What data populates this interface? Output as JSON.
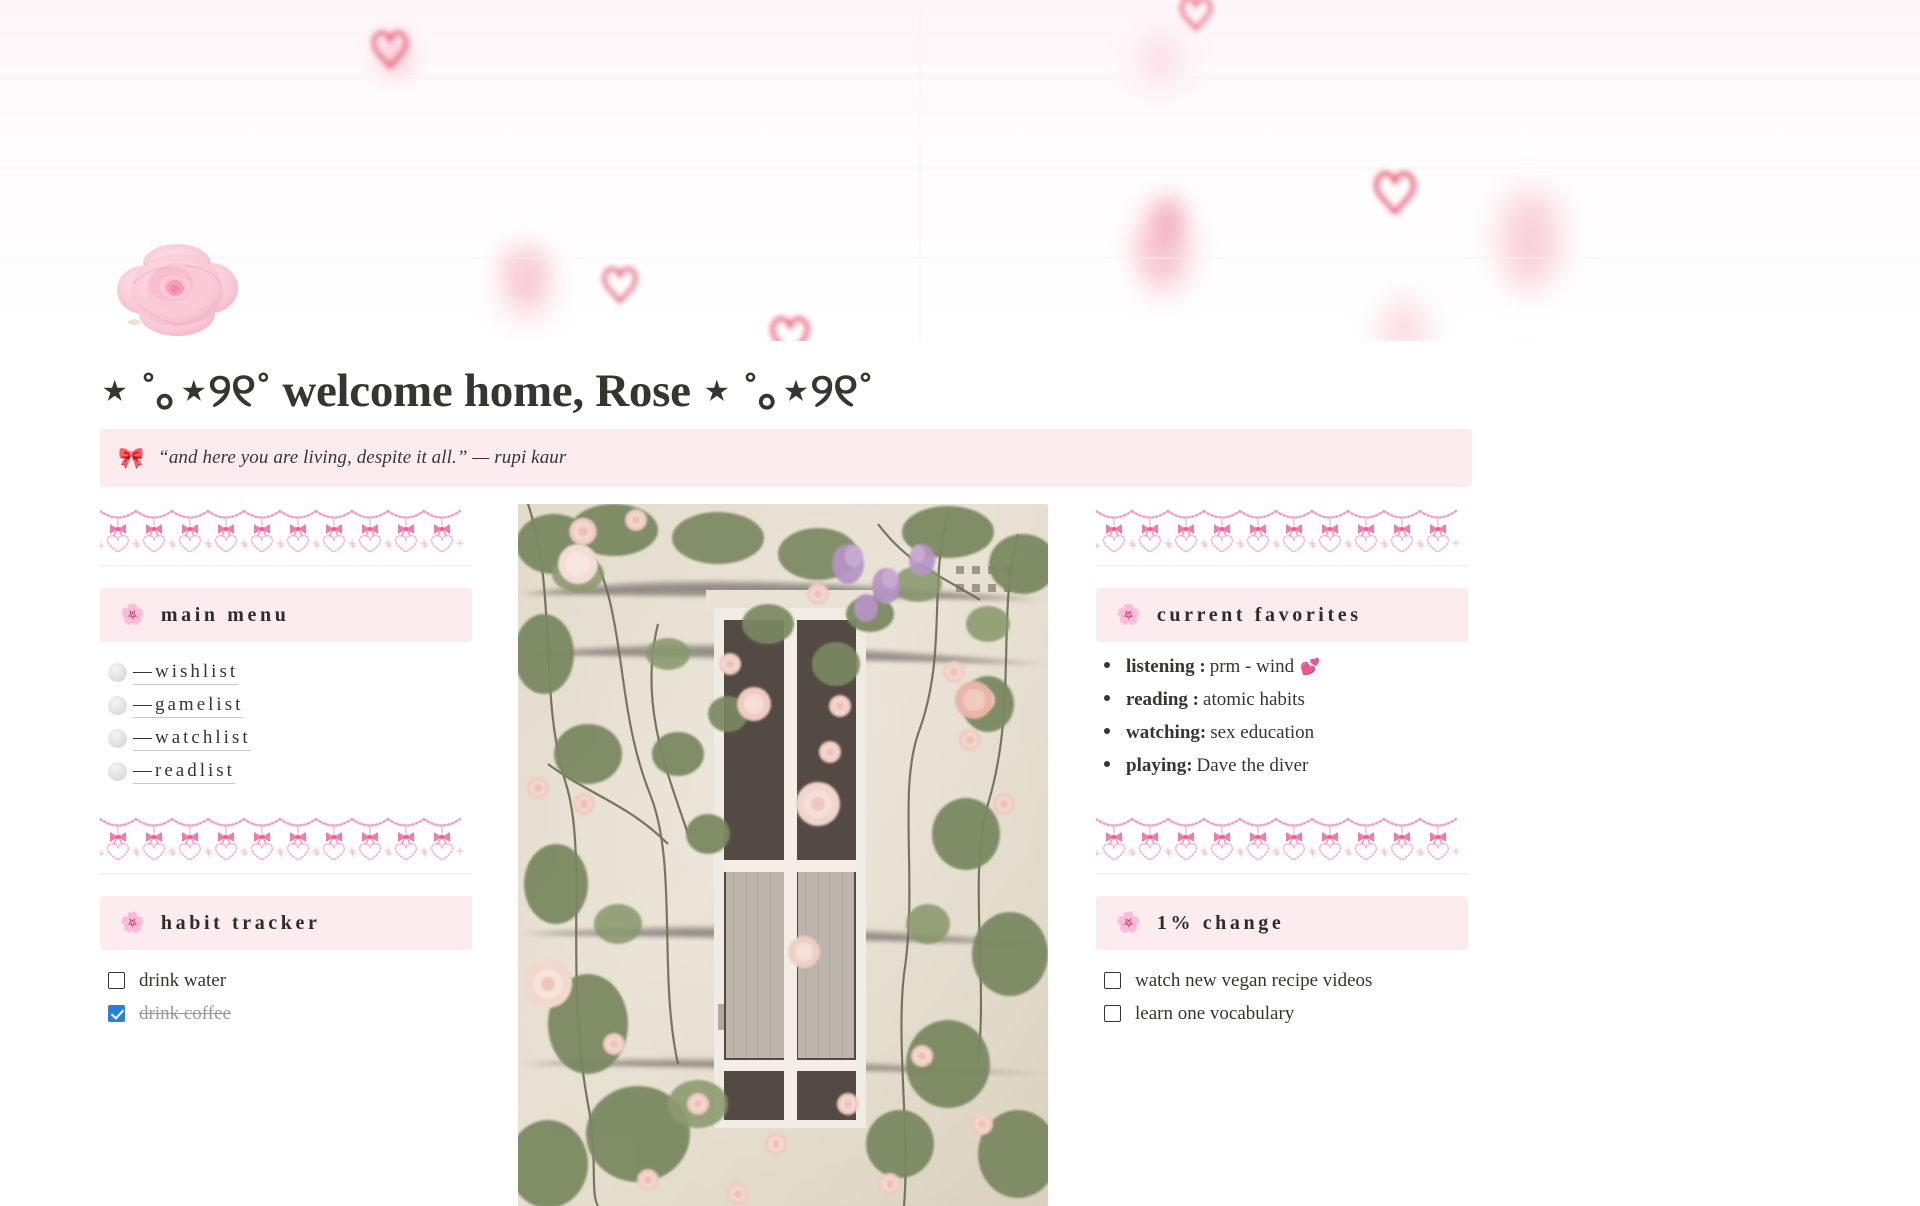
{
  "cover": {
    "name": "pink-hearts-cover",
    "background": "#fffdfd",
    "accent": "#e8617f"
  },
  "page": {
    "icon": "pink-rose",
    "title": "⋆ ˚｡⋆୨୧˚ welcome home, Rose ⋆ ˚｡⋆୨୧˚"
  },
  "callout": {
    "icon": "🎀",
    "icon_name": "pink-bow",
    "text": "“and here you are living, despite it all.” — rupi kaur",
    "background": "#fcecf0"
  },
  "theme": {
    "band_background": "#fcecf0",
    "text": "#37352f",
    "muted": "#9b9a97",
    "checkbox_checked": "#2383e2",
    "lace_pink": "#f5a8c4",
    "divider": "#ededec"
  },
  "left_column": {
    "divider_top": "lace-bow-heart-border",
    "main_menu": {
      "icon": "🌸",
      "icon_name": "cherry-blossom",
      "title": "main menu",
      "items": [
        {
          "bullet": "white-circle",
          "label": "—wishlist"
        },
        {
          "bullet": "white-circle",
          "label": "—gamelist"
        },
        {
          "bullet": "white-circle",
          "label": "—watchlist"
        },
        {
          "bullet": "white-circle",
          "label": "—readlist"
        }
      ]
    },
    "divider_mid": "lace-bow-heart-border",
    "habit_tracker": {
      "icon": "🌸",
      "icon_name": "cherry-blossom",
      "title": "habit tracker",
      "items": [
        {
          "text": "drink water",
          "checked": false
        },
        {
          "text": "drink coffee",
          "checked": true
        }
      ]
    }
  },
  "center_column": {
    "photo_name": "window-with-climbing-roses",
    "photo_alt": "vintage photo of a white window on a cream wall with climbing pink roses and lilac blossoms"
  },
  "right_column": {
    "divider_top": "lace-bow-heart-border",
    "current_favorites": {
      "icon": "🌸",
      "icon_name": "cherry-blossom",
      "title": "current favorites",
      "items": [
        {
          "label": "listening :",
          "value": "prm - wind",
          "emoji": "💕"
        },
        {
          "label": "reading :",
          "value": "atomic habits",
          "emoji": ""
        },
        {
          "label": "watching:",
          "value": "sex education",
          "emoji": ""
        },
        {
          "label": "playing:",
          "value": "Dave the diver",
          "emoji": ""
        }
      ]
    },
    "divider_mid": "lace-bow-heart-border",
    "one_percent_change": {
      "icon": "🌸",
      "icon_name": "cherry-blossom",
      "title": "1%  change",
      "items": [
        {
          "text": "watch new vegan recipe videos",
          "checked": false
        },
        {
          "text": "learn one vocabulary",
          "checked": false
        }
      ]
    }
  }
}
